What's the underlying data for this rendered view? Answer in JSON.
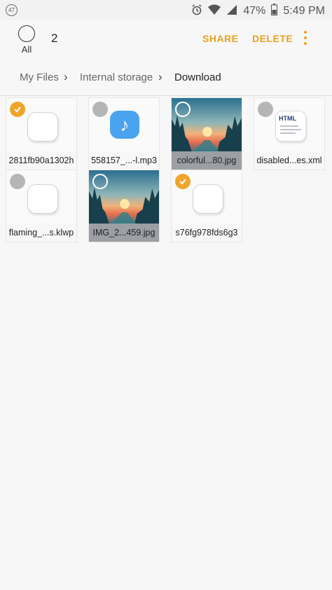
{
  "status_bar": {
    "notification_count": "47",
    "battery_percent": "47%",
    "time": "5:49 PM",
    "icons": [
      "alarm-icon",
      "wifi-icon",
      "signal-icon",
      "battery-icon"
    ]
  },
  "toolbar": {
    "select_all_label": "All",
    "selected_count": "2",
    "share_label": "SHARE",
    "delete_label": "DELETE",
    "accent_color": "#e8a21e"
  },
  "breadcrumb": {
    "items": [
      "My Files",
      "Internal storage",
      "Download"
    ]
  },
  "files": [
    {
      "name": "2811fb90a1302h",
      "type": "generic",
      "selected": true
    },
    {
      "name": "558157_...-l.mp3",
      "type": "audio",
      "selected": false
    },
    {
      "name": "colorful...80.jpg",
      "type": "image",
      "selected": false
    },
    {
      "name": "disabled...es.xml",
      "type": "html",
      "selected": false
    },
    {
      "name": "flaming_...s.klwp",
      "type": "generic",
      "selected": false
    },
    {
      "name": "IMG_2...459.jpg",
      "type": "image",
      "selected": false
    },
    {
      "name": "s76fg978fds6g3",
      "type": "generic",
      "selected": true
    }
  ],
  "html_icon_text": "HTML"
}
